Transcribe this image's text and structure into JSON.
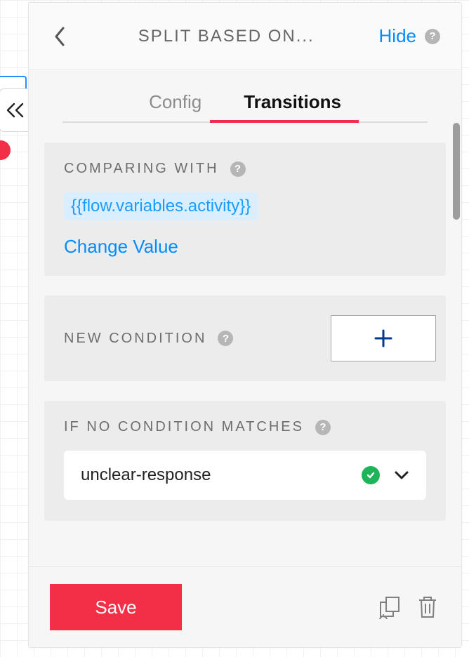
{
  "header": {
    "title": "SPLIT BASED ON...",
    "hide_label": "Hide"
  },
  "tabs": {
    "config_label": "Config",
    "transitions_label": "Transitions",
    "active": "transitions"
  },
  "comparing": {
    "label": "COMPARING WITH",
    "chip_value": "{{flow.variables.activity}}",
    "change_label": "Change Value"
  },
  "new_condition": {
    "label": "NEW CONDITION"
  },
  "no_match": {
    "label": "IF NO CONDITION MATCHES",
    "selected_value": "unclear-response"
  },
  "footer": {
    "save_label": "Save"
  }
}
